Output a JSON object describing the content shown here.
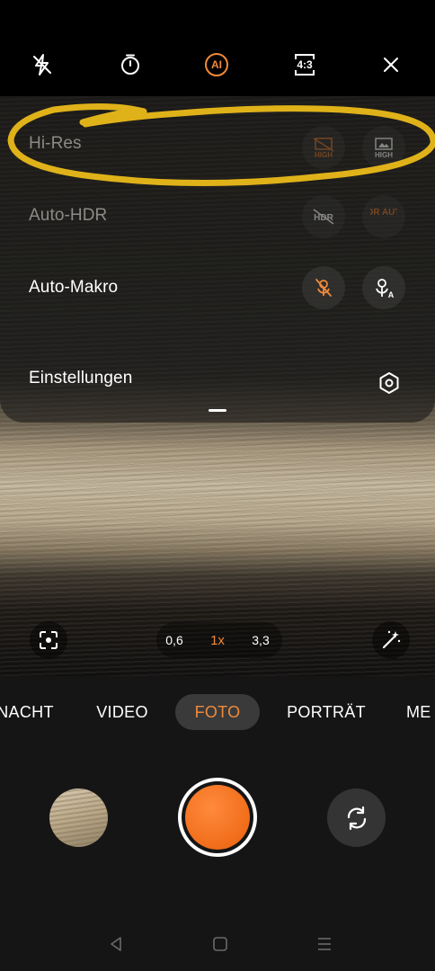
{
  "top_bar": {
    "flash": {
      "icon": "flash-off-icon"
    },
    "timer": {
      "icon": "timer-icon"
    },
    "ai": {
      "label": "AI",
      "color": "#f08a3a"
    },
    "aspect": {
      "label": "4:3"
    },
    "close": {
      "icon": "close-icon"
    }
  },
  "quick_settings": {
    "rows": [
      {
        "label": "Hi-Res",
        "options": [
          {
            "text": "HIGH",
            "icon": "hi-res-off-icon",
            "state": "disabled"
          },
          {
            "text": "HIGH",
            "icon": "hi-res-on-icon",
            "state": "disabled"
          }
        ]
      },
      {
        "label": "Auto-HDR",
        "options": [
          {
            "text": "HDR",
            "icon": "hdr-off-icon",
            "state": "disabled"
          },
          {
            "text": "HDR AUTO",
            "icon": "hdr-auto-icon",
            "state": "disabled"
          }
        ]
      },
      {
        "label": "Auto-Makro",
        "options": [
          {
            "icon": "macro-off-icon",
            "state": "selected"
          },
          {
            "text": "A",
            "icon": "macro-auto-icon",
            "state": "normal"
          }
        ]
      },
      {
        "label": "Einstellungen",
        "icon": "settings-icon"
      }
    ],
    "annotation_color": "#e0b21a"
  },
  "zoom": {
    "levels": [
      "0,6",
      "1x",
      "3,3"
    ],
    "selected": "1x",
    "focus_icon": "focus-icon",
    "magic_icon": "magic-wand-icon"
  },
  "modes": {
    "items": [
      "NACHT",
      "VIDEO",
      "FOTO",
      "PORTRÄT",
      "ME"
    ],
    "selected": "FOTO"
  },
  "controls": {
    "gallery": "gallery-thumbnail",
    "shutter": "shutter-button",
    "flip": "switch-camera-icon",
    "shutter_color": "#f06d1a"
  },
  "nav": [
    "back-icon",
    "home-icon",
    "menu-icon"
  ]
}
